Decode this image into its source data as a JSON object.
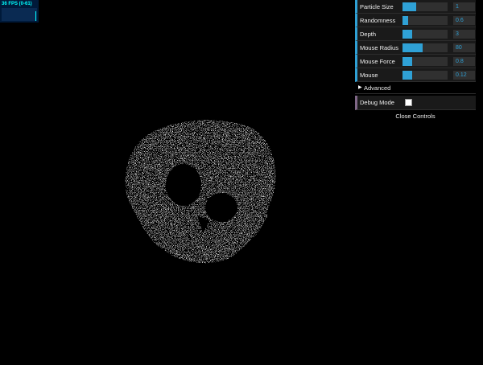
{
  "stats": {
    "fps_label": "36 FPS (0-61)"
  },
  "gui": {
    "controls": [
      {
        "label": "Particle Size",
        "value": "1",
        "fill": 0.3
      },
      {
        "label": "Randomness",
        "value": "0.6",
        "fill": 0.12
      },
      {
        "label": "Depth",
        "value": "3",
        "fill": 0.22
      },
      {
        "label": "Mouse Radius",
        "value": "80",
        "fill": 0.45
      },
      {
        "label": "Mouse Force",
        "value": "0.8",
        "fill": 0.22
      },
      {
        "label": "Mouse",
        "value": "0.12",
        "fill": 0.22
      }
    ],
    "advanced_label": "Advanced",
    "debug_label": "Debug Mode",
    "debug_checked": false,
    "close_label": "Close Controls"
  },
  "colors": {
    "accent": "#2fa1d6",
    "bg": "#000000",
    "row": "#1a1a1a",
    "debug_accent": "#806787"
  },
  "icons": {
    "folder": "triangle-right-icon"
  }
}
